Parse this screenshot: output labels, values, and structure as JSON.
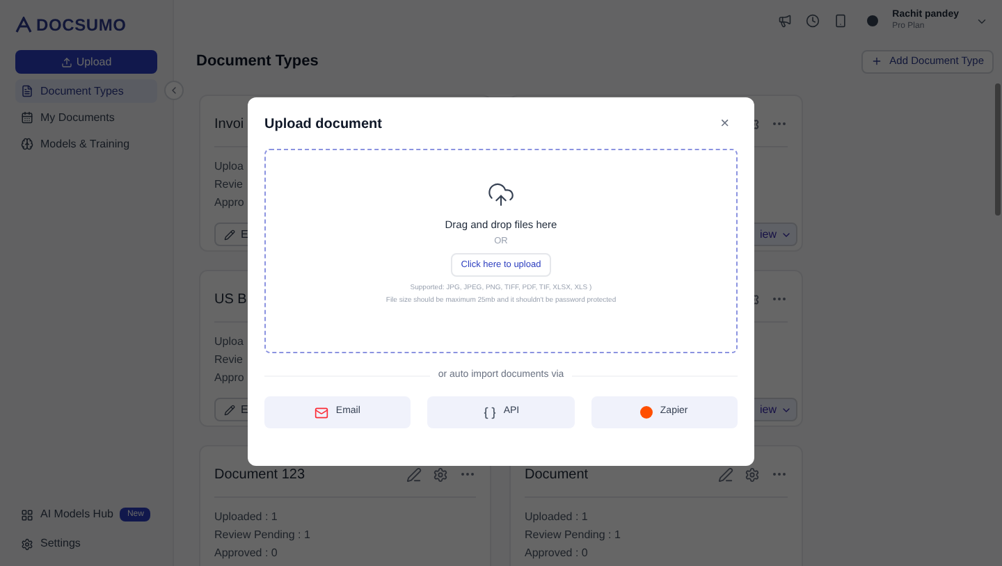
{
  "sidebar": {
    "logo": "DOCSUMO",
    "upload_button": "Upload",
    "items": [
      {
        "label": "Document Types",
        "selected": true
      },
      {
        "label": "My Documents",
        "selected": false
      },
      {
        "label": "Models & Training",
        "selected": false
      }
    ],
    "bottom_items": [
      {
        "label": "AI Models Hub",
        "badge": "New"
      },
      {
        "label": "Settings"
      }
    ]
  },
  "header": {
    "user_name": "Rachit pandey",
    "user_plan": "Pro Plan"
  },
  "page": {
    "title": "Document Types",
    "add_button": "Add Document Type"
  },
  "cards": [
    {
      "title": "Invoi",
      "stats": [
        "Uploa",
        "Revie",
        "Appro"
      ],
      "edit_button": "E"
    },
    {
      "review_button": "iew"
    },
    {
      "title": "US B",
      "stats": [
        "Uploa",
        "Revie",
        "Appro"
      ],
      "edit_button": "E"
    },
    {
      "review_button": "iew"
    },
    {
      "title": "Document 123",
      "stats": [
        "Uploaded : 1",
        "Review Pending : 1",
        "Approved : 0"
      ]
    },
    {
      "title": "Document",
      "stats": [
        "Uploaded : 1",
        "Review Pending : 1",
        "Approved : 0"
      ]
    }
  ],
  "modal": {
    "title": "Upload document",
    "close": "×",
    "drop_text": "Drag and drop files here",
    "or_text": "OR",
    "upload_button": "Click here to upload",
    "supported": "Supported: JPG, JPEG, PNG, TIFF, PDF, TIF, XLSX, XLS )",
    "size_note": "File size should be maximum 25mb and it shouldn't be password protected",
    "import_text": "or auto import documents via",
    "import_options": [
      {
        "kind": "email",
        "label": "Email"
      },
      {
        "kind": "api",
        "label": "API"
      },
      {
        "kind": "zapier",
        "label": "Zapier"
      }
    ]
  }
}
